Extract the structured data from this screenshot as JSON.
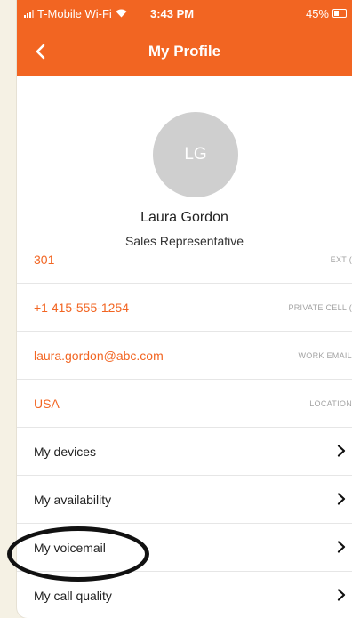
{
  "status_bar": {
    "carrier": "T-Mobile Wi-Fi",
    "time": "3:43 PM",
    "battery": "45%"
  },
  "header": {
    "title": "My Profile",
    "background_color": "#f26522"
  },
  "profile": {
    "initials": "LG",
    "name": "Laura Gordon",
    "role": "Sales Representative"
  },
  "info_rows": [
    {
      "value": "301",
      "label": "EXT ("
    },
    {
      "value": "+1 415-555-1254",
      "label": "PRIVATE CELL ("
    },
    {
      "value": "laura.gordon@abc.com",
      "label": "WORK EMAIL"
    },
    {
      "value": "USA",
      "label": "LOCATION"
    }
  ],
  "menu_items": [
    {
      "label": "My devices"
    },
    {
      "label": "My availability"
    },
    {
      "label": "My voicemail"
    },
    {
      "label": "My call quality"
    }
  ],
  "icons": {
    "back": "chevron-left-icon",
    "row_arrow": "chevron-right-icon",
    "signal": "signal-icon",
    "wifi": "wifi-icon",
    "battery": "battery-icon"
  },
  "annotation": {
    "highlighted_item": "My voicemail"
  }
}
